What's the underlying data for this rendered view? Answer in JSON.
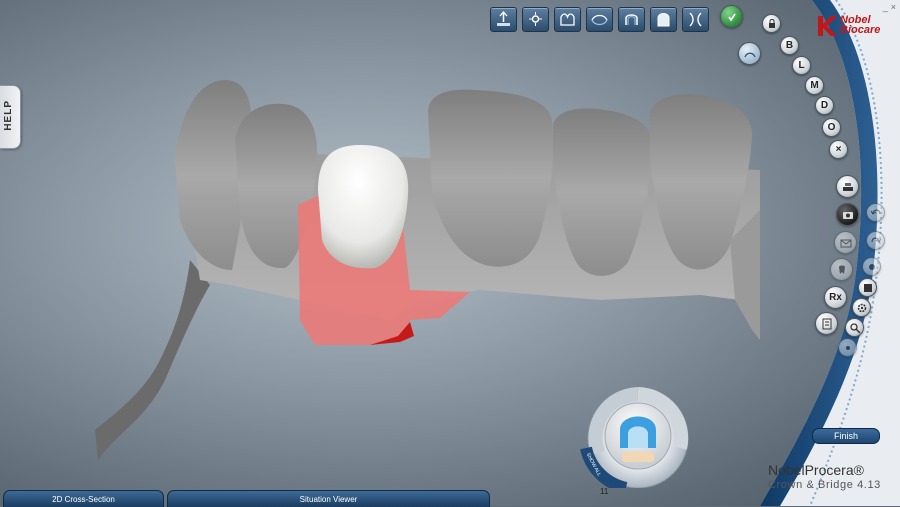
{
  "help": {
    "label": "HELP"
  },
  "toolbar": {
    "buttons": [
      {
        "name": "insertion-axis-icon"
      },
      {
        "name": "orientation-icon"
      },
      {
        "name": "margin-line-icon"
      },
      {
        "name": "cross-section-icon"
      },
      {
        "name": "coping-view-icon"
      },
      {
        "name": "full-anatomic-icon"
      },
      {
        "name": "gap-icon"
      }
    ]
  },
  "logo": {
    "line1": "Nobel",
    "line2": "Biocare"
  },
  "window_controls": {
    "minimize": "_",
    "close": "×"
  },
  "design_steps": {
    "b": "B",
    "l": "L",
    "m": "M",
    "d": "D",
    "o": "O",
    "x": "×"
  },
  "side_buttons": {
    "rx": "Rx"
  },
  "dial": {
    "show_all": "SHOW ALL"
  },
  "tooth_number": "11",
  "finish": {
    "label": "Finish"
  },
  "brand": {
    "name": "NobelProcera®",
    "subtitle": "Crown & Bridge 4.13"
  },
  "bottom_tabs": {
    "cross_section": "2D Cross-Section",
    "situation_viewer": "Situation Viewer"
  },
  "colors": {
    "accent_blue": "#1f4a78",
    "brand_red": "#c01818",
    "prep_red": "#e87070"
  }
}
